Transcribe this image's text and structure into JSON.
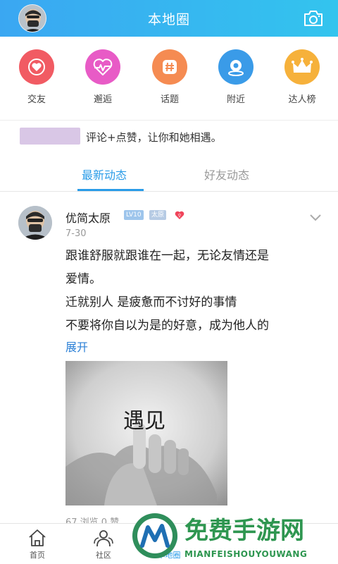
{
  "header": {
    "title": "本地圈"
  },
  "menu": [
    {
      "label": "交友",
      "color": "#f15b63"
    },
    {
      "label": "邂逅",
      "color": "#e85bc6"
    },
    {
      "label": "话题",
      "color": "#f58b52"
    },
    {
      "label": "附近",
      "color": "#3a9be8"
    },
    {
      "label": "达人榜",
      "color": "#f6b13b"
    }
  ],
  "tip": {
    "text": "评论+点赞，让你和她相遇。"
  },
  "tabs": {
    "active": "最新动态",
    "inactive": "好友动态"
  },
  "post": {
    "author": "优简太原",
    "level_badge": "LV10",
    "city_badge": "太原",
    "date": "7-30",
    "lines": [
      "跟谁舒服就跟谁在一起，无论友情还是",
      "爱情。",
      "迁就别人 是疲惫而不讨好的事情",
      "不要将你自以为是的好意，成为他人的"
    ],
    "expand_label": "展开",
    "photo_text": "遇见",
    "stats": "67 浏览    0 赞"
  },
  "bottom_nav": {
    "items": [
      {
        "label": "首页",
        "icon": "home-icon"
      },
      {
        "label": "社区",
        "icon": "community-icon"
      },
      {
        "label": "本地圈",
        "icon": "local-circle-icon"
      }
    ]
  },
  "watermark": {
    "title": "免费手游网",
    "subtitle": "MIANFEISHOUYOUWANG"
  }
}
